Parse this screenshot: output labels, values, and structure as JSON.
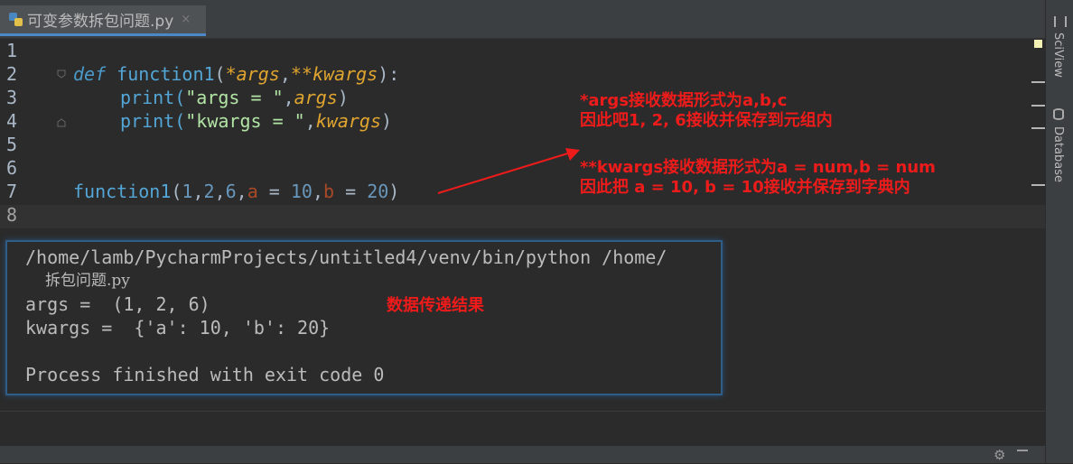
{
  "tab": {
    "label": "可变参数拆包问题.py",
    "close": "×"
  },
  "gutter": [
    "1",
    "2",
    "3",
    "4",
    "5",
    "6",
    "7",
    "8"
  ],
  "code": {
    "l2_def": "def",
    "l2_fname": "function1",
    "l2_open": "(",
    "l2_args": "*args",
    "l2_comma": ",",
    "l2_kwargs": "**kwargs",
    "l2_close": "):",
    "l3_print": "print(",
    "l3_str": "\"args = \"",
    "l3_comma": ",",
    "l3_args": "args",
    "l3_close": ")",
    "l4_print": "print(",
    "l4_str": "\"kwargs = \"",
    "l4_comma": ",",
    "l4_kwargs": "kwargs",
    "l4_close": ")",
    "l7_fname": "function1",
    "l7_open": "(",
    "l7_n1": "1",
    "l7_c1": ",",
    "l7_n2": "2",
    "l7_c2": ",",
    "l7_n3": "6",
    "l7_c3": ",",
    "l7_a": "a",
    "l7_eq1": " = ",
    "l7_n4": "10",
    "l7_c4": ",",
    "l7_b": "b",
    "l7_eq2": " = ",
    "l7_n5": "20",
    "l7_close": ")"
  },
  "annotations": {
    "args_line1": "*args接收数据形式为a,b,c",
    "args_line2": "因此吧1, 2, 6接收并保存到元组内",
    "kwargs_line1": "**kwargs接收数据形式为a = num,b = num",
    "kwargs_line2": "因此把 a = 10, b = 10接收并保存到字典内",
    "result": "数据传递结果"
  },
  "console": {
    "cmd": "/home/lamb/PycharmProjects/untitled4/venv/bin/python /home/",
    "cmd_wrap": "拆包问题.py",
    "args_out": "args =  (1, 2, 6)",
    "kwargs_out": "kwargs =  {'a': 10, 'b': 20}",
    "blank": "",
    "exit": "Process finished with exit code 0"
  },
  "side_tabs": {
    "sciview": "SciView",
    "database": "Database"
  },
  "colors": {
    "annotation": "#ee1b1b",
    "keyword": "#4b9ac9",
    "param": "#e0a52f",
    "string": "#b2e4a5",
    "number": "#6897bb",
    "kwarg": "#aa4926"
  }
}
